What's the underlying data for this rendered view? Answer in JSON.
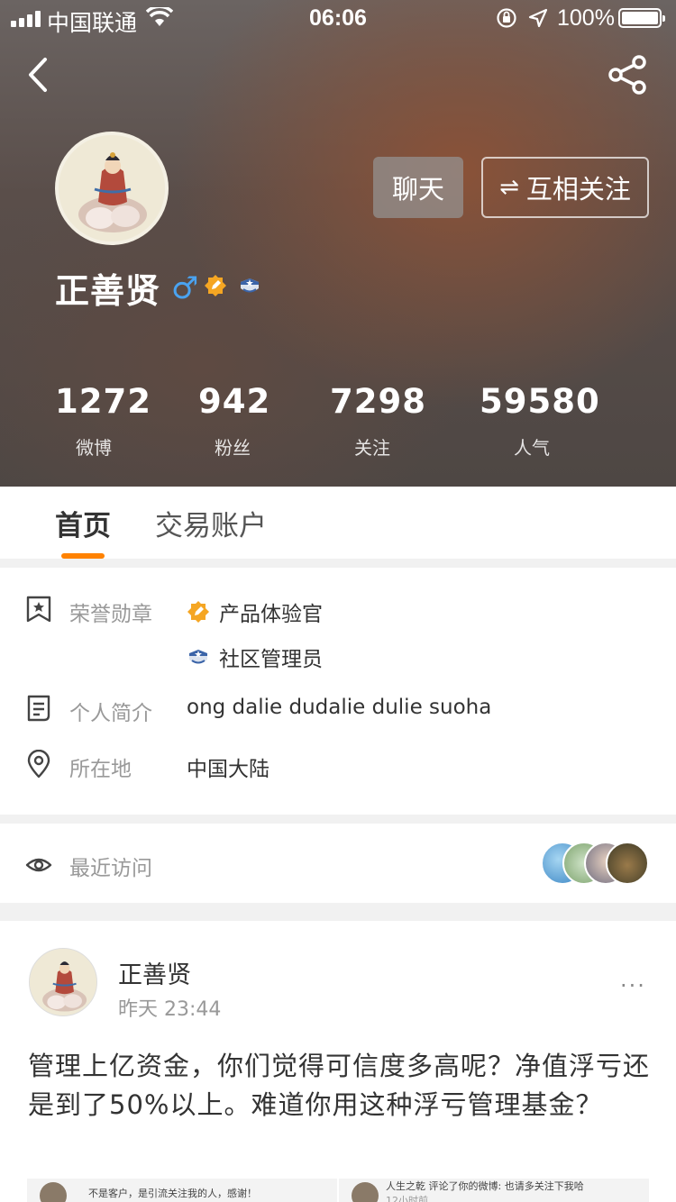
{
  "status_bar": {
    "carrier": "中国联通",
    "time": "06:06",
    "battery": "100%"
  },
  "profile": {
    "name": "正善贤",
    "gender_symbol": "♂",
    "actions": {
      "chat": "聊天",
      "follow_icon": "⇌",
      "follow": "互相关注"
    },
    "stats": [
      {
        "value": "1272",
        "label": "微博"
      },
      {
        "value": "942",
        "label": "粉丝"
      },
      {
        "value": "7298",
        "label": "关注"
      },
      {
        "value": "59580",
        "label": "人气"
      }
    ]
  },
  "tabs": [
    "首页",
    "交易账户"
  ],
  "info": {
    "honor_label": "荣誉勋章",
    "honors": [
      "产品体验官",
      "社区管理员"
    ],
    "bio_label": "个人简介",
    "bio": "ong dalie dudalie dulie suoha",
    "location_label": "所在地",
    "location": "中国大陆",
    "visits_label": "最近访问"
  },
  "post": {
    "author": "正善贤",
    "time": "昨天 23:44",
    "more": "···",
    "text": "管理上亿资金，你们觉得可信度多高呢？净值浮亏还是到了50%以上。难道你用这种浮亏管理基金？",
    "image_left_text": "不是客户，是引流关注我的人，感谢！",
    "image_right_title": "人生之乾 评论了你的微博: 也请多关注下我哈",
    "image_right_time": "12小时前"
  },
  "colors": {
    "accent": "#ff8200",
    "gender": "#4aa3f0"
  }
}
